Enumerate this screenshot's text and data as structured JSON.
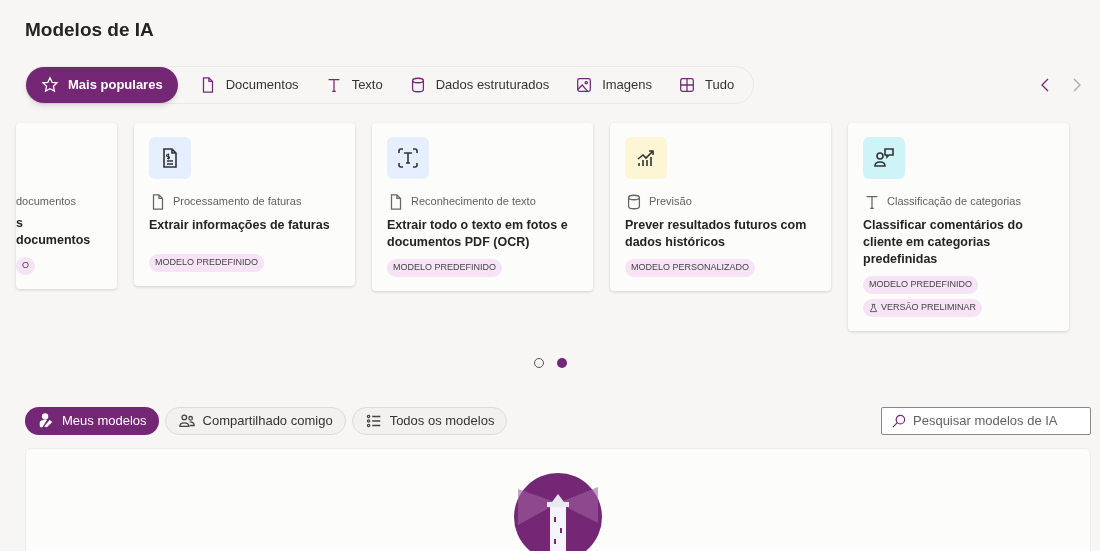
{
  "title": "Modelos de IA",
  "tabs": [
    {
      "label": "Mais populares",
      "kind": "star",
      "selected": true
    },
    {
      "label": "Documentos",
      "kind": "document",
      "selected": false
    },
    {
      "label": "Texto",
      "kind": "text",
      "selected": false
    },
    {
      "label": "Dados estruturados",
      "kind": "database",
      "selected": false
    },
    {
      "label": "Imagens",
      "kind": "image",
      "selected": false
    },
    {
      "label": "Tudo",
      "kind": "grid",
      "selected": false
    }
  ],
  "cards": [
    {
      "kind": "partial",
      "category": {
        "label": "documentos",
        "kind": "none"
      },
      "title": "s\ndocumentos",
      "badges": [
        {
          "kind": "plain",
          "label": "O"
        }
      ]
    },
    {
      "kind": "invoice",
      "category": {
        "label": "Processamento de faturas",
        "kind": "document"
      },
      "title": "Extrair informações de faturas",
      "badges": [
        {
          "kind": "plain",
          "label": "MODELO PREDEFINIDO"
        }
      ]
    },
    {
      "kind": "text-scan",
      "category": {
        "label": "Reconhecimento de texto",
        "kind": "document"
      },
      "title": "Extrair todo o texto em fotos e documentos PDF (OCR)",
      "badges": [
        {
          "kind": "plain",
          "label": "MODELO PREDEFINIDO"
        }
      ]
    },
    {
      "kind": "chart",
      "category": {
        "label": "Previsão",
        "kind": "database"
      },
      "title": "Prever resultados futuros com dados históricos",
      "badges": [
        {
          "kind": "plain",
          "label": "MODELO PERSONALIZADO"
        }
      ]
    },
    {
      "kind": "chat",
      "category": {
        "label": "Classificação de categorias",
        "kind": "text"
      },
      "title": "Classificar comentários do cliente em categorias predefinidas",
      "badges": [
        {
          "kind": "plain",
          "label": "MODELO PREDEFINIDO"
        },
        {
          "kind": "preview",
          "label": "VERSÃO PRELIMINAR"
        }
      ]
    }
  ],
  "pager": [
    {
      "selected": false
    },
    {
      "selected": true
    }
  ],
  "filters": [
    {
      "label": "Meus modelos",
      "kind": "person",
      "selected": true
    },
    {
      "label": "Compartilhado comigo",
      "kind": "people",
      "selected": false
    },
    {
      "label": "Todos os modelos",
      "kind": "list",
      "selected": false
    }
  ],
  "search": {
    "placeholder": "Pesquisar modelos de IA"
  }
}
